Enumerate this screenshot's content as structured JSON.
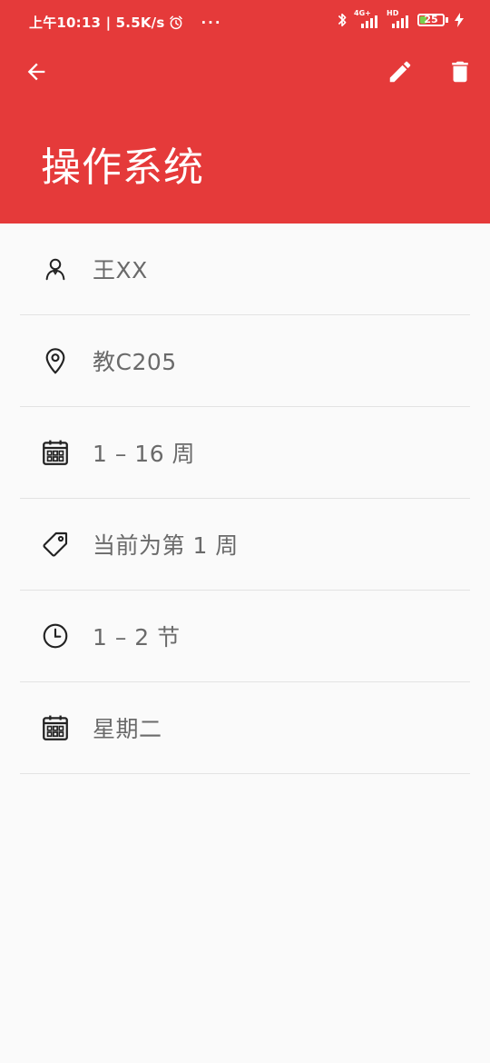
{
  "status_bar": {
    "time_speed": "上午10:13 | 5.5K/s",
    "more": "···",
    "network_1": "4G+",
    "network_2": "HD",
    "battery": "25"
  },
  "header": {
    "title": "操作系统",
    "background_color": "#e53a3a"
  },
  "details": [
    {
      "icon": "person-icon",
      "text": "王XX"
    },
    {
      "icon": "location-pin-icon",
      "text": "教C205"
    },
    {
      "icon": "calendar-icon",
      "text": "1 – 16 周"
    },
    {
      "icon": "tag-icon",
      "text": "当前为第 1 周"
    },
    {
      "icon": "clock-icon",
      "text": "1 – 2 节"
    },
    {
      "icon": "calendar-icon",
      "text": "星期二"
    }
  ]
}
